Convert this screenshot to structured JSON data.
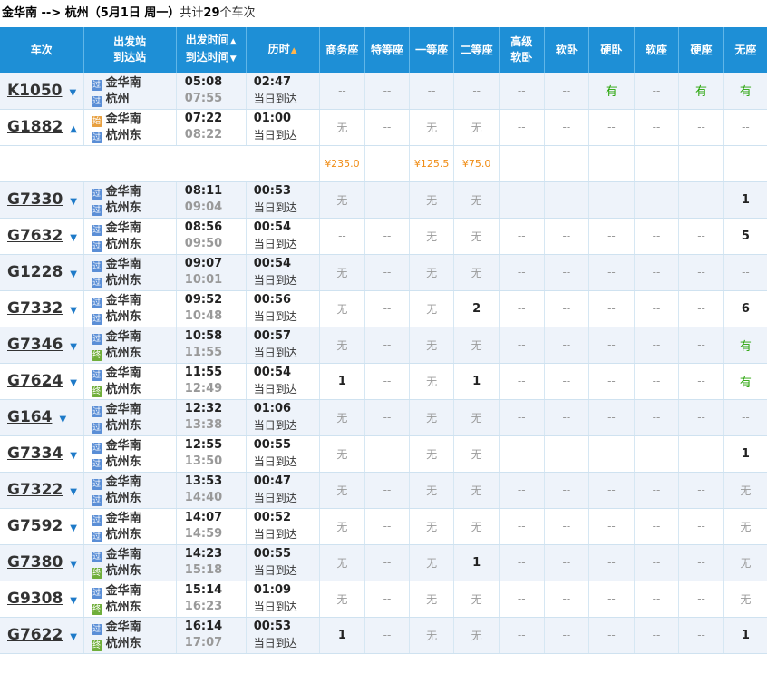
{
  "summary": {
    "from": "金华南",
    "arrow": " --> ",
    "to": "杭州",
    "date": "（5月1日  周一）",
    "count_prefix": "共计",
    "count": "29",
    "count_suffix": "个车次"
  },
  "header": {
    "train": "车次",
    "station_top": "出发站",
    "station_bottom": "到达站",
    "time_top": "出发时间",
    "time_bottom": "到达时间",
    "duration": "历时",
    "seats": [
      "商务座",
      "特等座",
      "一等座",
      "二等座",
      "高级软卧",
      "软卧",
      "硬卧",
      "软座",
      "硬座",
      "无座"
    ]
  },
  "icons": {
    "pass": "过",
    "start": "始",
    "end": "终"
  },
  "same_day_label": "当日到达",
  "trains": [
    {
      "no": "K1050",
      "expanded": false,
      "from": "金华南",
      "from_icon": "pass",
      "to": "杭州",
      "to_icon": "pass",
      "dep": "05:08",
      "arr": "07:55",
      "dur": "02:47",
      "seats": [
        "--",
        "--",
        "--",
        "--",
        "--",
        "--",
        "有",
        "--",
        "有",
        "有"
      ]
    },
    {
      "no": "G1882",
      "expanded": true,
      "from": "金华南",
      "from_icon": "start",
      "to": "杭州东",
      "to_icon": "pass",
      "dep": "07:22",
      "arr": "08:22",
      "dur": "01:00",
      "seats": [
        "无",
        "--",
        "无",
        "无",
        "--",
        "--",
        "--",
        "--",
        "--",
        "--"
      ],
      "prices": [
        "¥235.0",
        "",
        "¥125.5",
        "¥75.0",
        "",
        "",
        "",
        "",
        "",
        ""
      ]
    },
    {
      "no": "G7330",
      "expanded": false,
      "from": "金华南",
      "from_icon": "pass",
      "to": "杭州东",
      "to_icon": "pass",
      "dep": "08:11",
      "arr": "09:04",
      "dur": "00:53",
      "seats": [
        "无",
        "--",
        "无",
        "无",
        "--",
        "--",
        "--",
        "--",
        "--",
        "1"
      ]
    },
    {
      "no": "G7632",
      "expanded": false,
      "from": "金华南",
      "from_icon": "pass",
      "to": "杭州东",
      "to_icon": "pass",
      "dep": "08:56",
      "arr": "09:50",
      "dur": "00:54",
      "seats": [
        "--",
        "--",
        "无",
        "无",
        "--",
        "--",
        "--",
        "--",
        "--",
        "5"
      ]
    },
    {
      "no": "G1228",
      "expanded": false,
      "from": "金华南",
      "from_icon": "pass",
      "to": "杭州东",
      "to_icon": "pass",
      "dep": "09:07",
      "arr": "10:01",
      "dur": "00:54",
      "seats": [
        "无",
        "--",
        "无",
        "无",
        "--",
        "--",
        "--",
        "--",
        "--",
        "--"
      ]
    },
    {
      "no": "G7332",
      "expanded": false,
      "from": "金华南",
      "from_icon": "pass",
      "to": "杭州东",
      "to_icon": "pass",
      "dep": "09:52",
      "arr": "10:48",
      "dur": "00:56",
      "seats": [
        "无",
        "--",
        "无",
        "2",
        "--",
        "--",
        "--",
        "--",
        "--",
        "6"
      ]
    },
    {
      "no": "G7346",
      "expanded": false,
      "from": "金华南",
      "from_icon": "pass",
      "to": "杭州东",
      "to_icon": "end",
      "dep": "10:58",
      "arr": "11:55",
      "dur": "00:57",
      "seats": [
        "无",
        "--",
        "无",
        "无",
        "--",
        "--",
        "--",
        "--",
        "--",
        "有"
      ]
    },
    {
      "no": "G7624",
      "expanded": false,
      "from": "金华南",
      "from_icon": "pass",
      "to": "杭州东",
      "to_icon": "end",
      "dep": "11:55",
      "arr": "12:49",
      "dur": "00:54",
      "seats": [
        "1",
        "--",
        "无",
        "1",
        "--",
        "--",
        "--",
        "--",
        "--",
        "有"
      ]
    },
    {
      "no": "G164",
      "expanded": false,
      "from": "金华南",
      "from_icon": "pass",
      "to": "杭州东",
      "to_icon": "pass",
      "dep": "12:32",
      "arr": "13:38",
      "dur": "01:06",
      "seats": [
        "无",
        "--",
        "无",
        "无",
        "--",
        "--",
        "--",
        "--",
        "--",
        "--"
      ]
    },
    {
      "no": "G7334",
      "expanded": false,
      "from": "金华南",
      "from_icon": "pass",
      "to": "杭州东",
      "to_icon": "pass",
      "dep": "12:55",
      "arr": "13:50",
      "dur": "00:55",
      "seats": [
        "无",
        "--",
        "无",
        "无",
        "--",
        "--",
        "--",
        "--",
        "--",
        "1"
      ]
    },
    {
      "no": "G7322",
      "expanded": false,
      "from": "金华南",
      "from_icon": "pass",
      "to": "杭州东",
      "to_icon": "pass",
      "dep": "13:53",
      "arr": "14:40",
      "dur": "00:47",
      "seats": [
        "无",
        "--",
        "无",
        "无",
        "--",
        "--",
        "--",
        "--",
        "--",
        "无"
      ]
    },
    {
      "no": "G7592",
      "expanded": false,
      "from": "金华南",
      "from_icon": "pass",
      "to": "杭州东",
      "to_icon": "pass",
      "dep": "14:07",
      "arr": "14:59",
      "dur": "00:52",
      "seats": [
        "无",
        "--",
        "无",
        "无",
        "--",
        "--",
        "--",
        "--",
        "--",
        "无"
      ]
    },
    {
      "no": "G7380",
      "expanded": false,
      "from": "金华南",
      "from_icon": "pass",
      "to": "杭州东",
      "to_icon": "end",
      "dep": "14:23",
      "arr": "15:18",
      "dur": "00:55",
      "seats": [
        "无",
        "--",
        "无",
        "1",
        "--",
        "--",
        "--",
        "--",
        "--",
        "无"
      ]
    },
    {
      "no": "G9308",
      "expanded": false,
      "from": "金华南",
      "from_icon": "pass",
      "to": "杭州东",
      "to_icon": "end",
      "dep": "15:14",
      "arr": "16:23",
      "dur": "01:09",
      "seats": [
        "无",
        "--",
        "无",
        "无",
        "--",
        "--",
        "--",
        "--",
        "--",
        "无"
      ]
    },
    {
      "no": "G7622",
      "expanded": false,
      "from": "金华南",
      "from_icon": "pass",
      "to": "杭州东",
      "to_icon": "end",
      "dep": "16:14",
      "arr": "17:07",
      "dur": "00:53",
      "seats": [
        "1",
        "--",
        "无",
        "无",
        "--",
        "--",
        "--",
        "--",
        "--",
        "1"
      ]
    }
  ]
}
